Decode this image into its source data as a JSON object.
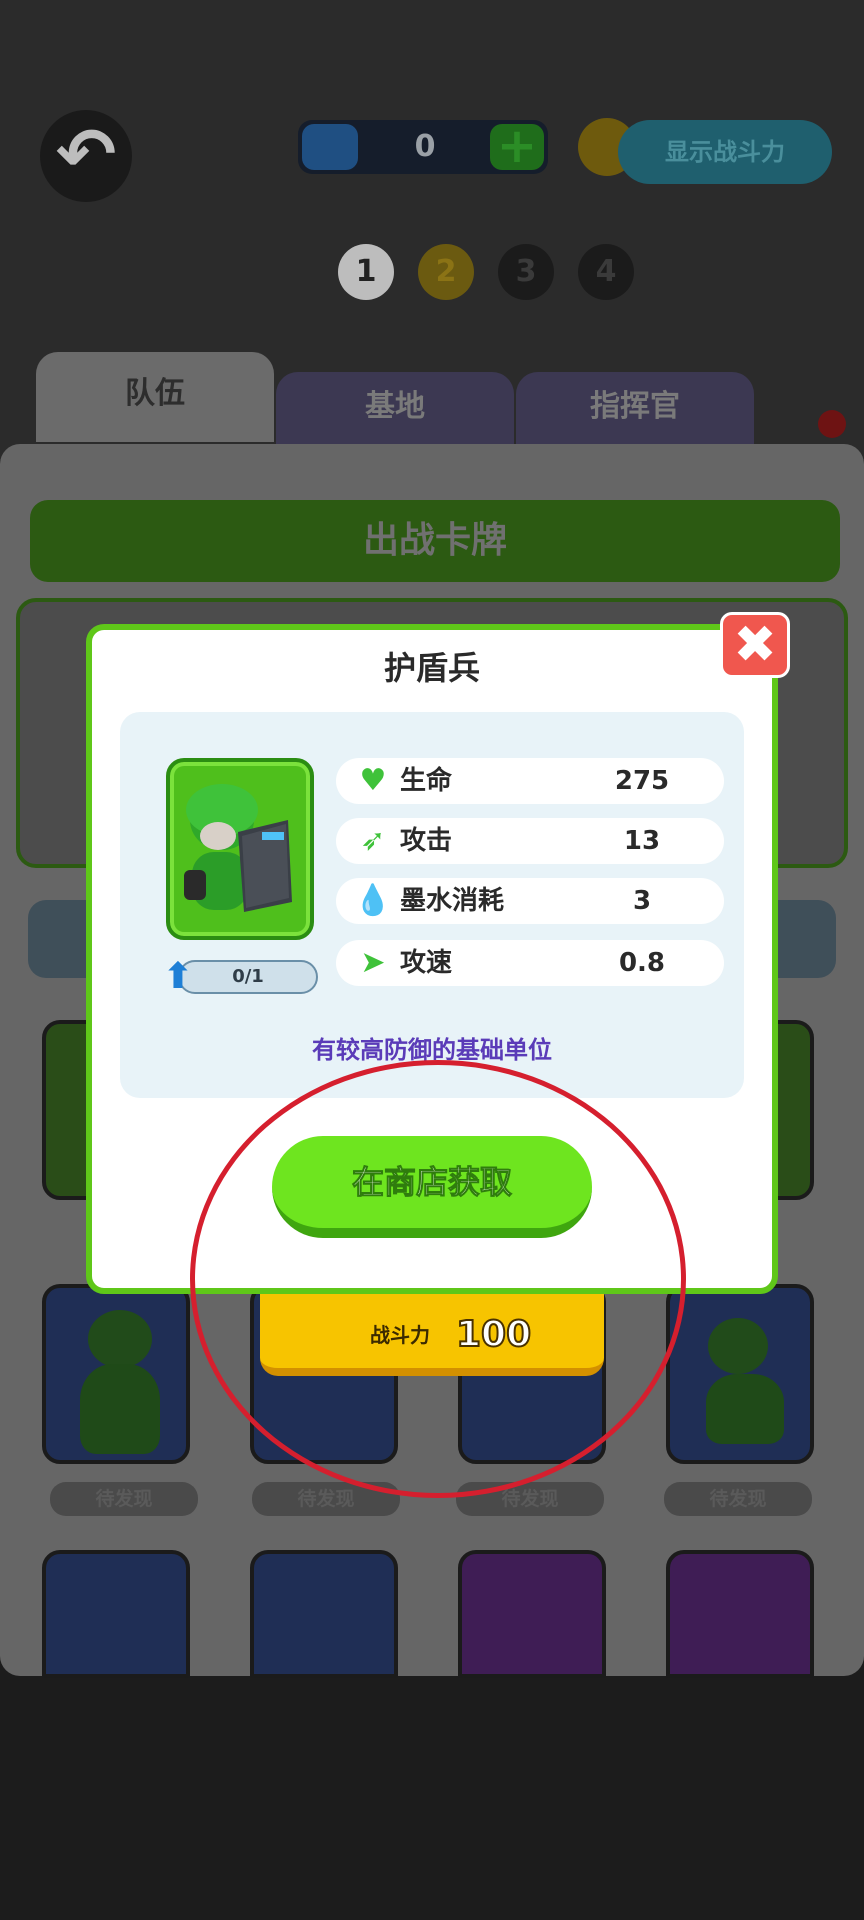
{
  "header": {
    "currency_value": "0",
    "show_power_label": "显示战斗力",
    "stages": [
      "1",
      "2",
      "3",
      "4"
    ]
  },
  "tabs": [
    "队伍",
    "基地",
    "指挥官"
  ],
  "deck": {
    "title": "出战卡牌"
  },
  "unit_cards": [
    {
      "status": "待发现"
    },
    {
      "status": "待发现"
    },
    {
      "status": "待发现"
    },
    {
      "status": "待发现"
    }
  ],
  "power": {
    "label": "战斗力",
    "value": "100"
  },
  "modal": {
    "title": "护盾兵",
    "level_progress": "0/1",
    "stats": [
      {
        "icon": "heart-icon",
        "name": "生命",
        "value": "275"
      },
      {
        "icon": "bullet-icon",
        "name": "攻击",
        "value": "13"
      },
      {
        "icon": "ink-drop-icon",
        "name": "墨水消耗",
        "value": "3"
      },
      {
        "icon": "speed-icon",
        "name": "攻速",
        "value": "0.8"
      }
    ],
    "description": "有较高防御的基础单位",
    "shop_button": "在商店获取"
  },
  "colors": {
    "accent_green": "#6ee51f",
    "modal_border": "#5fc719",
    "close_red": "#f0574e",
    "description_purple": "#5a3bb8",
    "annotation_circle": "#d51f2e"
  }
}
